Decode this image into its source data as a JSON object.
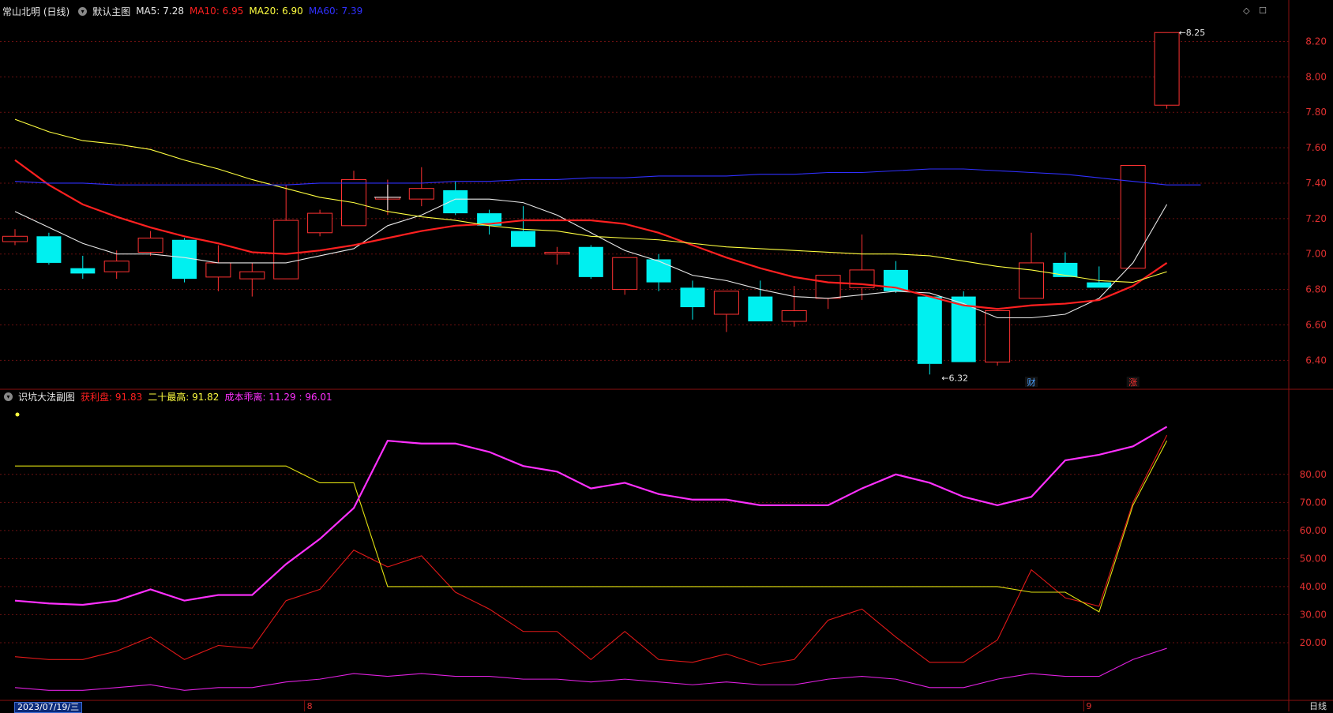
{
  "main_header": {
    "stock": "常山北明 (日线)",
    "template": "默认主图",
    "legend": [
      {
        "text": "MA5: 7.28",
        "color": "#e8e8e8"
      },
      {
        "text": "MA10: 6.95",
        "color": "#ff2020"
      },
      {
        "text": "MA20: 6.90",
        "color": "#ffff40"
      },
      {
        "text": "MA60: 7.39",
        "color": "#3030ff"
      }
    ]
  },
  "sub_header": {
    "name": "识坑大法副图",
    "legend": [
      {
        "text": "获利盘: 91.83",
        "color": "#ff2020"
      },
      {
        "text": "二十最高: 91.82",
        "color": "#ffff40"
      },
      {
        "text": "成本乖离: 11.29 : 96.01",
        "color": "#ff30ff"
      }
    ]
  },
  "bottom_bar": {
    "date": "2023/07/19/三",
    "month_labels": [
      {
        "text": "8",
        "x_index": 9
      },
      {
        "text": "9",
        "x_index": 32
      }
    ],
    "period": "日线"
  },
  "annotations": {
    "high_label": "8.25",
    "low_label": "6.32",
    "event_tags": [
      {
        "text": "财",
        "x_index": 30,
        "color": "#4aa0ff"
      },
      {
        "text": "涨",
        "x_index": 33,
        "color": "#ff3030"
      }
    ]
  },
  "chart_data": [
    {
      "type": "candlestick",
      "ylim": [
        6.25,
        8.3
      ],
      "yticks": [
        "6.40",
        "6.60",
        "6.80",
        "7.00",
        "7.20",
        "7.40",
        "7.60",
        "7.80",
        "8.00",
        "8.20"
      ],
      "candles": [
        {
          "o": 7.07,
          "h": 7.14,
          "l": 7.05,
          "c": 7.1
        },
        {
          "o": 7.1,
          "h": 7.12,
          "l": 6.94,
          "c": 6.95
        },
        {
          "o": 6.92,
          "h": 6.99,
          "l": 6.86,
          "c": 6.89
        },
        {
          "o": 6.9,
          "h": 7.02,
          "l": 6.86,
          "c": 6.96
        },
        {
          "o": 7.01,
          "h": 7.13,
          "l": 6.99,
          "c": 7.09
        },
        {
          "o": 7.08,
          "h": 7.09,
          "l": 6.84,
          "c": 6.86
        },
        {
          "o": 6.87,
          "h": 7.05,
          "l": 6.79,
          "c": 6.95
        },
        {
          "o": 6.86,
          "h": 6.95,
          "l": 6.76,
          "c": 6.9
        },
        {
          "o": 6.86,
          "h": 7.39,
          "l": 6.86,
          "c": 7.19
        },
        {
          "o": 7.12,
          "h": 7.25,
          "l": 7.1,
          "c": 7.23
        },
        {
          "o": 7.16,
          "h": 7.47,
          "l": 7.16,
          "c": 7.42
        },
        {
          "o": 7.31,
          "h": 7.42,
          "l": 7.22,
          "c": 7.32
        },
        {
          "o": 7.31,
          "h": 7.49,
          "l": 7.27,
          "c": 7.37
        },
        {
          "o": 7.36,
          "h": 7.41,
          "l": 7.22,
          "c": 7.23
        },
        {
          "o": 7.23,
          "h": 7.25,
          "l": 7.11,
          "c": 7.16
        },
        {
          "o": 7.13,
          "h": 7.27,
          "l": 7.04,
          "c": 7.04
        },
        {
          "o": 7.0,
          "h": 7.04,
          "l": 6.94,
          "c": 7.01
        },
        {
          "o": 7.04,
          "h": 7.05,
          "l": 6.86,
          "c": 6.87
        },
        {
          "o": 6.8,
          "h": 6.98,
          "l": 6.77,
          "c": 6.98
        },
        {
          "o": 6.97,
          "h": 7.0,
          "l": 6.79,
          "c": 6.84
        },
        {
          "o": 6.81,
          "h": 6.85,
          "l": 6.63,
          "c": 6.7
        },
        {
          "o": 6.66,
          "h": 6.79,
          "l": 6.56,
          "c": 6.79
        },
        {
          "o": 6.76,
          "h": 6.85,
          "l": 6.62,
          "c": 6.62
        },
        {
          "o": 6.62,
          "h": 6.82,
          "l": 6.59,
          "c": 6.68
        },
        {
          "o": 6.75,
          "h": 6.88,
          "l": 6.69,
          "c": 6.88
        },
        {
          "o": 6.81,
          "h": 7.11,
          "l": 6.74,
          "c": 6.91
        },
        {
          "o": 6.91,
          "h": 6.96,
          "l": 6.78,
          "c": 6.79
        },
        {
          "o": 6.76,
          "h": 6.76,
          "l": 6.32,
          "c": 6.38
        },
        {
          "o": 6.76,
          "h": 6.79,
          "l": 6.39,
          "c": 6.39
        },
        {
          "o": 6.39,
          "h": 6.68,
          "l": 6.37,
          "c": 6.68
        },
        {
          "o": 6.75,
          "h": 7.12,
          "l": 6.75,
          "c": 6.95
        },
        {
          "o": 6.95,
          "h": 7.01,
          "l": 6.87,
          "c": 6.87
        },
        {
          "o": 6.84,
          "h": 6.93,
          "l": 6.81,
          "c": 6.81
        },
        {
          "o": 6.92,
          "h": 7.5,
          "l": 6.92,
          "c": 7.5
        },
        {
          "o": 7.84,
          "h": 8.25,
          "l": 7.82,
          "c": 8.25
        }
      ],
      "ma": [
        {
          "name": "MA5",
          "color": "#e8e8e8",
          "values": [
            7.24,
            7.15,
            7.06,
            7.0,
            7.0,
            6.98,
            6.95,
            6.95,
            6.95,
            6.99,
            7.03,
            7.16,
            7.22,
            7.31,
            7.31,
            7.29,
            7.22,
            7.12,
            7.02,
            6.96,
            6.88,
            6.85,
            6.8,
            6.76,
            6.75,
            6.77,
            6.79,
            6.78,
            6.72,
            6.64,
            6.64,
            6.66,
            6.75,
            6.95,
            7.28
          ]
        },
        {
          "name": "MA10",
          "color": "#ff2020",
          "values": [
            7.53,
            7.39,
            7.28,
            7.21,
            7.15,
            7.1,
            7.06,
            7.01,
            7.0,
            7.02,
            7.05,
            7.09,
            7.13,
            7.16,
            7.17,
            7.19,
            7.19,
            7.19,
            7.17,
            7.12,
            7.05,
            6.98,
            6.92,
            6.87,
            6.84,
            6.83,
            6.81,
            6.76,
            6.71,
            6.69,
            6.71,
            6.72,
            6.74,
            6.82,
            6.95
          ]
        },
        {
          "name": "MA20",
          "color": "#ffff40",
          "values": [
            7.76,
            7.69,
            7.64,
            7.62,
            7.59,
            7.53,
            7.48,
            7.42,
            7.37,
            7.32,
            7.29,
            7.24,
            7.21,
            7.19,
            7.16,
            7.14,
            7.13,
            7.1,
            7.09,
            7.08,
            7.06,
            7.04,
            7.03,
            7.02,
            7.01,
            7.0,
            7.0,
            6.99,
            6.96,
            6.93,
            6.91,
            6.88,
            6.85,
            6.84,
            6.9
          ]
        },
        {
          "name": "MA60",
          "color": "#3030ff",
          "values": [
            7.41,
            7.4,
            7.4,
            7.39,
            7.39,
            7.39,
            7.39,
            7.39,
            7.39,
            7.4,
            7.4,
            7.4,
            7.4,
            7.41,
            7.41,
            7.42,
            7.42,
            7.43,
            7.43,
            7.44,
            7.44,
            7.44,
            7.45,
            7.45,
            7.46,
            7.46,
            7.47,
            7.48,
            7.48,
            7.47,
            7.46,
            7.45,
            7.43,
            7.41,
            7.39,
            7.39
          ]
        }
      ]
    },
    {
      "type": "line",
      "ylim": [
        0,
        105
      ],
      "yticks": [
        "20.00",
        "30.00",
        "40.00",
        "50.00",
        "60.00",
        "70.00",
        "80.00"
      ],
      "series": [
        {
          "name": "获利盘",
          "color": "#e01818",
          "values": [
            15,
            14,
            14,
            17,
            22,
            14,
            19,
            18,
            35,
            39,
            53,
            47,
            51,
            38,
            32,
            24,
            24,
            14,
            24,
            14,
            13,
            16,
            12,
            14,
            28,
            32,
            22,
            13,
            13,
            21,
            46,
            36,
            33,
            70,
            94
          ]
        },
        {
          "name": "二十最高",
          "color": "#e0e010",
          "values": [
            83,
            83,
            83,
            83,
            83,
            83,
            83,
            83,
            83,
            77,
            77,
            40,
            40,
            40,
            40,
            40,
            40,
            40,
            40,
            40,
            40,
            40,
            40,
            40,
            40,
            40,
            40,
            40,
            40,
            40,
            38,
            38,
            31,
            69,
            92
          ]
        },
        {
          "name": "成本乖离",
          "color": "#ff30ff",
          "values": [
            35,
            34,
            33.5,
            35,
            39,
            35,
            37,
            37,
            48,
            57,
            68,
            92,
            91,
            91,
            88,
            83,
            81,
            75,
            77,
            73,
            71,
            71,
            69,
            69,
            69,
            75,
            80,
            77,
            72,
            69,
            72,
            85,
            87,
            90,
            97,
            100
          ]
        },
        {
          "name": "成本乖离2",
          "color": "#e020e0",
          "values": [
            4,
            3,
            3,
            4,
            5,
            3,
            4,
            4,
            6,
            7,
            9,
            8,
            9,
            8,
            8,
            7,
            7,
            6,
            7,
            6,
            5,
            6,
            5,
            5,
            7,
            8,
            7,
            4,
            4,
            7,
            9,
            8,
            8,
            14,
            18
          ]
        }
      ]
    }
  ]
}
